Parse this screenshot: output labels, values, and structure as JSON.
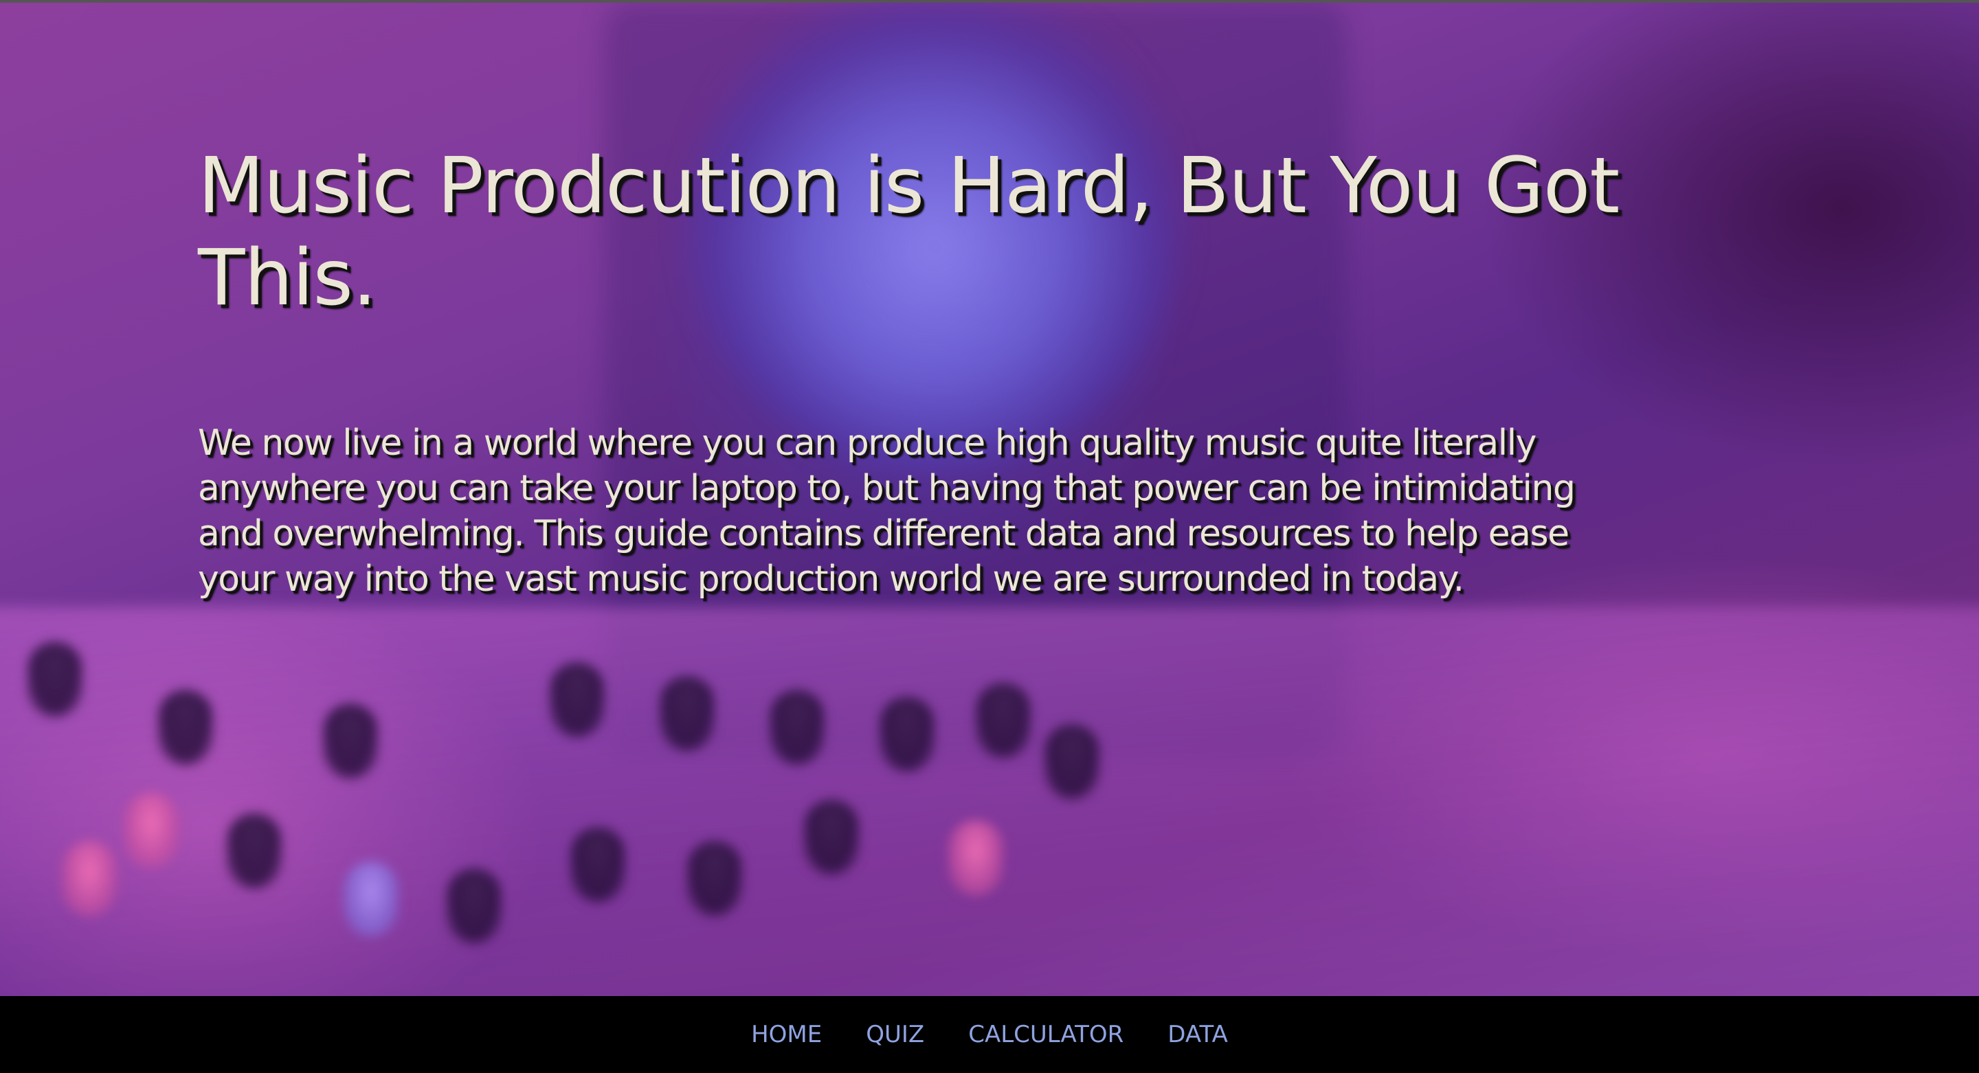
{
  "hero": {
    "title": "Music Prodcution is Hard, But You Got This.",
    "body": "We now live in a world where you can produce high quality music quite literally anywhere you can take your laptop to, but having that power can be intimidating and overwhelming. This guide contains different data and resources to help ease your way into the vast music production world we are surrounded in today."
  },
  "nav": {
    "items": [
      {
        "label": "HOME"
      },
      {
        "label": "QUIZ"
      },
      {
        "label": "CALCULATOR"
      },
      {
        "label": "DATA"
      }
    ]
  },
  "colors": {
    "text": "#ece6d6",
    "nav_link": "#8fa3e0",
    "nav_background": "#000000"
  }
}
